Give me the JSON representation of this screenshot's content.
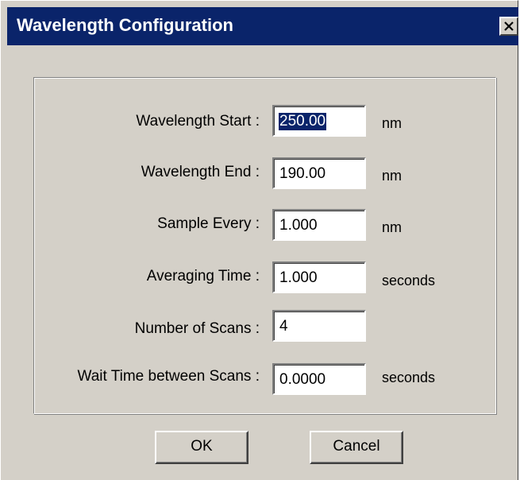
{
  "window": {
    "title": "Wavelength Configuration",
    "close_icon": "close-icon"
  },
  "fields": [
    {
      "label": "Wavelength Start :",
      "value": "250.00",
      "unit": "nm",
      "selected": true
    },
    {
      "label": "Wavelength End :",
      "value": "190.00",
      "unit": "nm"
    },
    {
      "label": "Sample Every :",
      "value": "1.000",
      "unit": "nm"
    },
    {
      "label": "Averaging Time :",
      "value": "1.000",
      "unit": "seconds"
    },
    {
      "label": "Number of Scans :",
      "value": "4",
      "unit": ""
    },
    {
      "label": "Wait Time between Scans :",
      "value": "0.0000",
      "unit": "seconds"
    }
  ],
  "buttons": {
    "ok": "OK",
    "cancel": "Cancel"
  },
  "colors": {
    "titlebar": "#0a246a",
    "dialog_face": "#d4d0c8",
    "selection": "#0a246a"
  }
}
